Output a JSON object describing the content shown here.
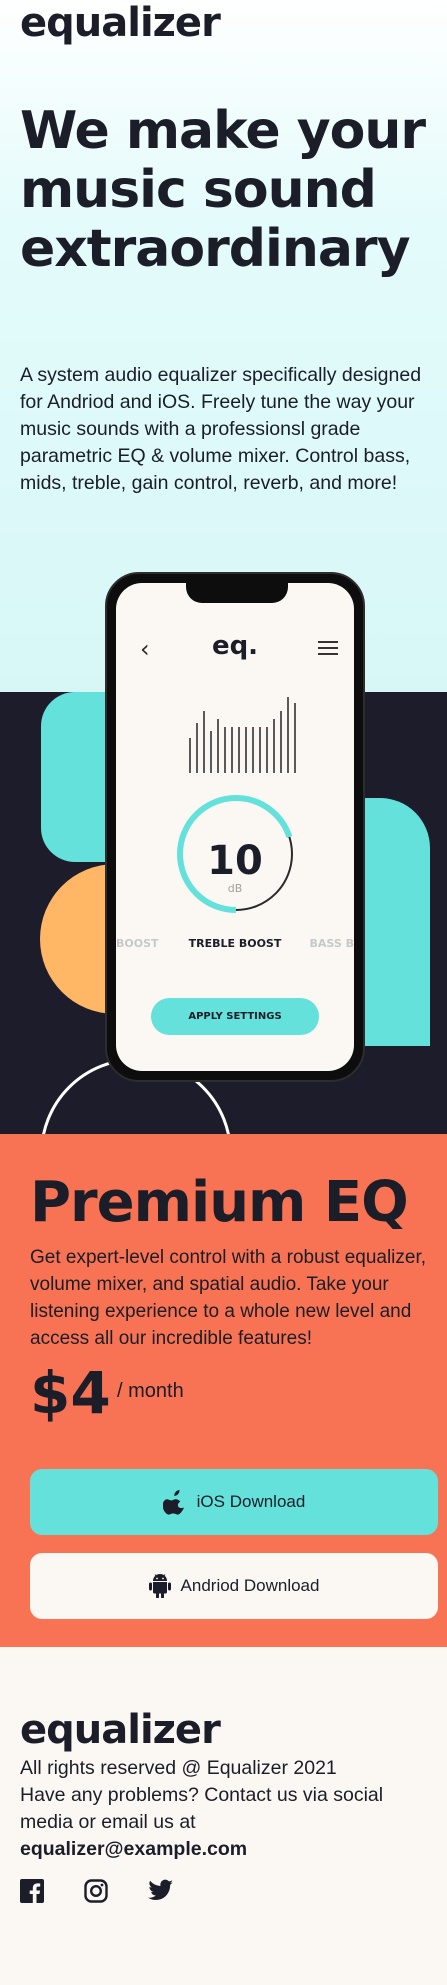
{
  "brand": {
    "logo_text": "equalizer"
  },
  "hero": {
    "title": "We make your music sound extraordinary",
    "description": "A system audio equalizer specifically designed for Andriod and iOS. Freely tune the way your music sounds with a professionsl grade parametric EQ & volume mixer. Control bass, mids, treble, gain control, reverb, and more!"
  },
  "phone_app": {
    "title": "eq.",
    "dial_value": "10",
    "dial_unit": "dB",
    "dial_level_fraction": 0.7,
    "presets": [
      "BOOST",
      "TREBLE BOOST",
      "BASS B"
    ],
    "apply_label": "APPLY SETTINGS",
    "icons": {
      "back": "chevron-left-icon",
      "menu": "hamburger-menu-icon"
    }
  },
  "premium": {
    "title": "Premium EQ",
    "description": "Get expert-level control with a robust equalizer, volume mixer, and spatial audio. Take your listening experience to a whole new level and access all our incredible features!",
    "price": "$4",
    "period": "/ month",
    "ios_label": "iOS Download",
    "android_label": "Andriod Download",
    "icons": {
      "ios": "apple-icon",
      "android": "android-icon"
    }
  },
  "footer": {
    "logo_text": "equalizer",
    "rights": "All rights reserved @ Equalizer 2021",
    "contact": "Have any problems? Contact us via social media or email us at",
    "email": "equalizer@example.com",
    "social_icons": [
      "facebook-icon",
      "instagram-icon",
      "twitter-icon"
    ]
  },
  "colors": {
    "dark": "#1d1c2a",
    "teal": "#64e1da",
    "orange": "#ffb765",
    "coral": "#f87353",
    "cream": "#fbf8f3"
  }
}
